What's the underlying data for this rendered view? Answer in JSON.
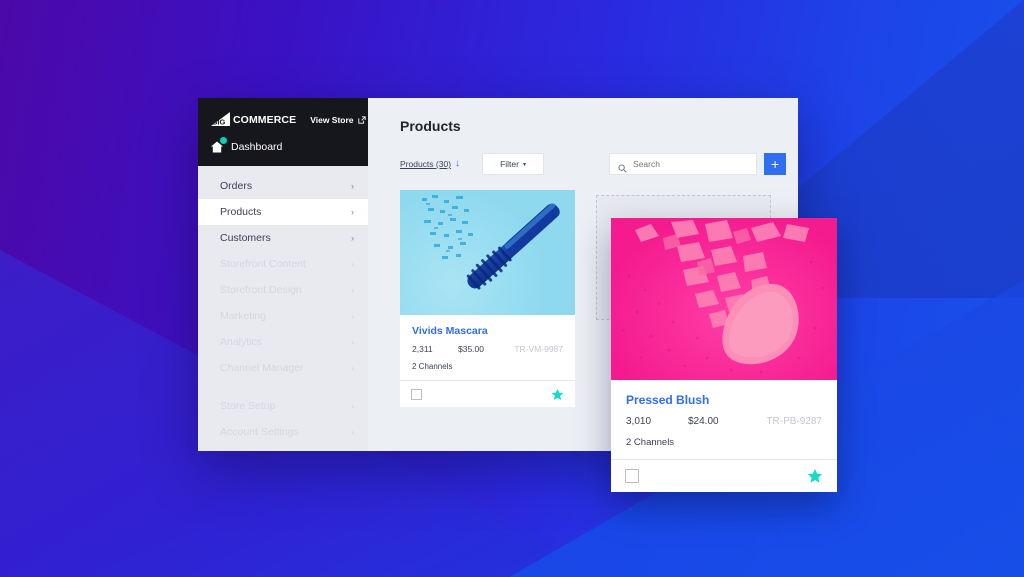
{
  "sidebar": {
    "brand": {
      "word": "COMMERCE",
      "mark_text": "BIG",
      "logo_icon": "bigcommerce-flag-icon"
    },
    "view_store": {
      "label": "View Store",
      "icon": "external-link-icon"
    },
    "dashboard": {
      "label": "Dashboard",
      "icon": "home-icon",
      "badge": true
    },
    "items": [
      {
        "label": "Orders",
        "active": false,
        "dim": false,
        "chevron": "›"
      },
      {
        "label": "Products",
        "active": true,
        "dim": false,
        "chevron": "›"
      },
      {
        "label": "Customers",
        "active": false,
        "dim": false,
        "chevron": "›"
      },
      {
        "label": "Storefront Content",
        "active": false,
        "dim": true,
        "chevron": "›"
      },
      {
        "label": "Storefront Design",
        "active": false,
        "dim": true,
        "chevron": "›"
      },
      {
        "label": "Marketing",
        "active": false,
        "dim": true,
        "chevron": "›"
      },
      {
        "label": "Analytics",
        "active": false,
        "dim": true,
        "chevron": "›"
      },
      {
        "label": "Channel Manager",
        "active": false,
        "dim": true,
        "chevron": "›"
      },
      {
        "label": "Store Setup",
        "active": false,
        "dim": true,
        "chevron": "›",
        "gap_before": true
      },
      {
        "label": "Account Settings",
        "active": false,
        "dim": true,
        "chevron": "›"
      }
    ]
  },
  "main": {
    "title": "Products",
    "toolbar": {
      "sort_label": "Products (30)",
      "sort_arrow": "↓",
      "filter_label": "Filter",
      "filter_caret": "▾",
      "search_placeholder": "Search",
      "search_value": "",
      "add_label": "+"
    },
    "products": [
      {
        "name": "Vivids Mascara",
        "quantity": "2,311",
        "price": "$35.00",
        "sku": "TR-VM-9987",
        "channels": "2 Channels",
        "image": "mascara-photo",
        "favorite": true,
        "selected": false
      },
      {
        "name": "Pressed Blush",
        "quantity": "3,010",
        "price": "$24.00",
        "sku": "TR-PB-9287",
        "channels": "2 Channels",
        "image": "blush-photo",
        "favorite": true,
        "selected": false
      }
    ]
  },
  "colors": {
    "accent_blue": "#2f6ef0",
    "star_teal": "#17dbc7",
    "sidebar_dark": "#16161d",
    "sidebar_light": "#e8eaf0",
    "canvas": "#eceff4",
    "badge_teal": "#00d4b5",
    "bg_gradient_from": "#4c08a8",
    "bg_gradient_to": "#1654ea"
  }
}
